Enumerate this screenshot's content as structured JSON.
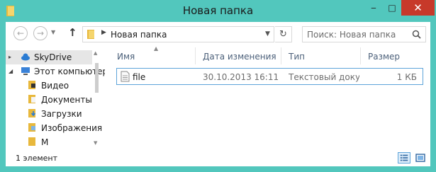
{
  "window": {
    "title": "Новая папка",
    "buttons": {
      "minimize": "‒",
      "maximize": "□",
      "close": "✕"
    }
  },
  "nav": {
    "back_icon": "arrow-left-icon",
    "forward_icon": "arrow-right-icon",
    "up_icon": "arrow-up-icon",
    "address_path": "Новая папка",
    "search_placeholder": "Поиск: Новая папка"
  },
  "sidebar": {
    "items": [
      {
        "label": "SkyDrive",
        "icon": "cloud-icon"
      },
      {
        "label": "Этот компьютер",
        "icon": "computer-icon"
      },
      {
        "label": "Видео",
        "icon": "video-folder-icon"
      },
      {
        "label": "Документы",
        "icon": "documents-folder-icon"
      },
      {
        "label": "Загрузки",
        "icon": "downloads-folder-icon"
      },
      {
        "label": "Изображения",
        "icon": "pictures-folder-icon"
      },
      {
        "label": "М",
        "icon": "music-folder-icon"
      }
    ]
  },
  "columns": [
    "Имя",
    "Дата изменения",
    "Тип",
    "Размер"
  ],
  "files": [
    {
      "name": "file",
      "date": "30.10.2013 16:11",
      "type": "Текстовый доку...",
      "size": "1 КБ"
    }
  ],
  "status": {
    "count_text": "1 элемент"
  },
  "colors": {
    "frame": "#52c7bd",
    "close_button": "#c7392a",
    "selection_border": "#5da4d9",
    "header_text": "#4c607a"
  }
}
